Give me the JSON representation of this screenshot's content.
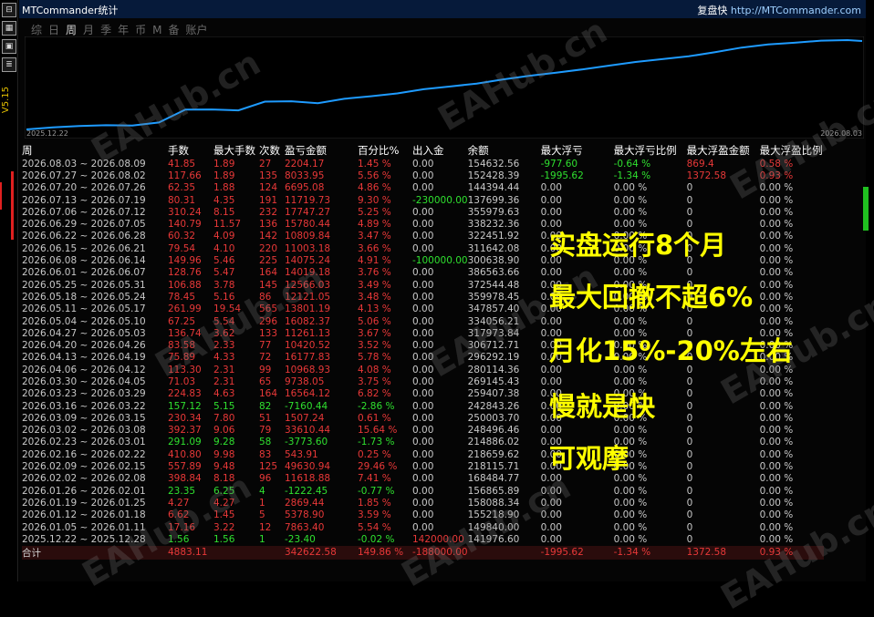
{
  "app": {
    "title": "MTCommander统计",
    "brand": "复盘快",
    "url": "http://MTCommander.com",
    "version": "V5.15"
  },
  "left_icons": [
    "minimize-icon",
    "grid-icon",
    "panel-icon",
    "list-icon",
    "check-icon"
  ],
  "left_icon_glyphs": [
    "⊟",
    "▦",
    "▣",
    "≣",
    "✓"
  ],
  "tabs": [
    {
      "label": "综"
    },
    {
      "label": "日"
    },
    {
      "label": "周"
    },
    {
      "label": "月"
    },
    {
      "label": "季"
    },
    {
      "label": "年"
    },
    {
      "label": "币"
    },
    {
      "label": "M"
    },
    {
      "label": "备"
    },
    {
      "label": "账户"
    }
  ],
  "active_tab_index": 2,
  "chart": {
    "start_label": "2025.12.22",
    "end_label": "2026.08.03",
    "line_color": "#1e9bff"
  },
  "columns": [
    "周",
    "手数",
    "最大手数",
    "次数",
    "盈亏金额",
    "百分比%",
    "出入金",
    "余额",
    "最大浮亏",
    "最大浮亏比例",
    "最大浮盈金额",
    "最大浮盈比例"
  ],
  "rows": [
    [
      "2026.08.03 ~ 2026.08.09",
      "41.85",
      "1.89",
      "27",
      "2204.17",
      "1.45 %",
      "0.00",
      "154632.56",
      "-977.60",
      "-0.64 %",
      "869.4",
      "0.58 %"
    ],
    [
      "2026.07.27 ~ 2026.08.02",
      "117.66",
      "1.89",
      "135",
      "8033.95",
      "5.56 %",
      "0.00",
      "152428.39",
      "-1995.62",
      "-1.34 %",
      "1372.58",
      "0.93 %"
    ],
    [
      "2026.07.20 ~ 2026.07.26",
      "62.35",
      "1.88",
      "124",
      "6695.08",
      "4.86 %",
      "0.00",
      "144394.44",
      "0.00",
      "0.00 %",
      "0",
      "0.00 %"
    ],
    [
      "2026.07.13 ~ 2026.07.19",
      "80.31",
      "4.35",
      "191",
      "11719.73",
      "9.30 %",
      "-230000.00",
      "137699.36",
      "0.00",
      "0.00 %",
      "0",
      "0.00 %"
    ],
    [
      "2026.07.06 ~ 2026.07.12",
      "310.24",
      "8.15",
      "232",
      "17747.27",
      "5.25 %",
      "0.00",
      "355979.63",
      "0.00",
      "0.00 %",
      "0",
      "0.00 %"
    ],
    [
      "2026.06.29 ~ 2026.07.05",
      "140.79",
      "11.57",
      "136",
      "15780.44",
      "4.89 %",
      "0.00",
      "338232.36",
      "0.00",
      "0.00 %",
      "0",
      "0.00 %"
    ],
    [
      "2026.06.22 ~ 2026.06.28",
      "60.32",
      "4.09",
      "142",
      "10809.84",
      "3.47 %",
      "0.00",
      "322451.92",
      "0.00",
      "0.00 %",
      "0",
      "0.00 %"
    ],
    [
      "2026.06.15 ~ 2026.06.21",
      "79.54",
      "4.10",
      "220",
      "11003.18",
      "3.66 %",
      "0.00",
      "311642.08",
      "0.00",
      "0.00 %",
      "0",
      "0.00 %"
    ],
    [
      "2026.06.08 ~ 2026.06.14",
      "149.96",
      "5.46",
      "225",
      "14075.24",
      "4.91 %",
      "-100000.00",
      "300638.90",
      "0.00",
      "0.00 %",
      "0",
      "0.00 %"
    ],
    [
      "2026.06.01 ~ 2026.06.07",
      "128.76",
      "5.47",
      "164",
      "14019.18",
      "3.76 %",
      "0.00",
      "386563.66",
      "0.00",
      "0.00 %",
      "0",
      "0.00 %"
    ],
    [
      "2026.05.25 ~ 2026.05.31",
      "106.88",
      "3.78",
      "145",
      "12566.03",
      "3.49 %",
      "0.00",
      "372544.48",
      "0.00",
      "0.00 %",
      "0",
      "0.00 %"
    ],
    [
      "2026.05.18 ~ 2026.05.24",
      "78.45",
      "5.16",
      "86",
      "12121.05",
      "3.48 %",
      "0.00",
      "359978.45",
      "0.00",
      "0.00 %",
      "0",
      "0.00 %"
    ],
    [
      "2026.05.11 ~ 2026.05.17",
      "261.99",
      "19.54",
      "565",
      "13801.19",
      "4.13 %",
      "0.00",
      "347857.40",
      "0.00",
      "0.00 %",
      "0",
      "0.00 %"
    ],
    [
      "2026.05.04 ~ 2026.05.10",
      "67.25",
      "5.54",
      "296",
      "16082.37",
      "5.06 %",
      "0.00",
      "334056.21",
      "0.00",
      "0.00 %",
      "0",
      "0.00 %"
    ],
    [
      "2026.04.27 ~ 2026.05.03",
      "136.74",
      "3.62",
      "133",
      "11261.13",
      "3.67 %",
      "0.00",
      "317973.84",
      "0.00",
      "0.00 %",
      "0",
      "0.00 %"
    ],
    [
      "2026.04.20 ~ 2026.04.26",
      "83.58",
      "2.33",
      "77",
      "10420.52",
      "3.52 %",
      "0.00",
      "306712.71",
      "0.00",
      "0.00 %",
      "0",
      "0.00 %"
    ],
    [
      "2026.04.13 ~ 2026.04.19",
      "75.89",
      "4.33",
      "72",
      "16177.83",
      "5.78 %",
      "0.00",
      "296292.19",
      "0.00",
      "0.00 %",
      "0",
      "0.00 %"
    ],
    [
      "2026.04.06 ~ 2026.04.12",
      "113.30",
      "2.31",
      "99",
      "10968.93",
      "4.08 %",
      "0.00",
      "280114.36",
      "0.00",
      "0.00 %",
      "0",
      "0.00 %"
    ],
    [
      "2026.03.30 ~ 2026.04.05",
      "71.03",
      "2.31",
      "65",
      "9738.05",
      "3.75 %",
      "0.00",
      "269145.43",
      "0.00",
      "0.00 %",
      "0",
      "0.00 %"
    ],
    [
      "2026.03.23 ~ 2026.03.29",
      "224.83",
      "4.63",
      "164",
      "16564.12",
      "6.82 %",
      "0.00",
      "259407.38",
      "0.00",
      "0.00 %",
      "0",
      "0.00 %"
    ],
    [
      "2026.03.16 ~ 2026.03.22",
      "157.12",
      "5.15",
      "82",
      "-7160.44",
      "-2.86 %",
      "0.00",
      "242843.26",
      "0.00",
      "0.00 %",
      "0",
      "0.00 %"
    ],
    [
      "2026.03.09 ~ 2026.03.15",
      "230.34",
      "7.80",
      "51",
      "1507.24",
      "0.61 %",
      "0.00",
      "250003.70",
      "0.00",
      "0.00 %",
      "0",
      "0.00 %"
    ],
    [
      "2026.03.02 ~ 2026.03.08",
      "392.37",
      "9.06",
      "79",
      "33610.44",
      "15.64 %",
      "0.00",
      "248496.46",
      "0.00",
      "0.00 %",
      "0",
      "0.00 %"
    ],
    [
      "2026.02.23 ~ 2026.03.01",
      "291.09",
      "9.28",
      "58",
      "-3773.60",
      "-1.73 %",
      "0.00",
      "214886.02",
      "0.00",
      "0.00 %",
      "0",
      "0.00 %"
    ],
    [
      "2026.02.16 ~ 2026.02.22",
      "410.80",
      "9.98",
      "83",
      "543.91",
      "0.25 %",
      "0.00",
      "218659.62",
      "0.00",
      "0.00 %",
      "0",
      "0.00 %"
    ],
    [
      "2026.02.09 ~ 2026.02.15",
      "557.89",
      "9.48",
      "125",
      "49630.94",
      "29.46 %",
      "0.00",
      "218115.71",
      "0.00",
      "0.00 %",
      "0",
      "0.00 %"
    ],
    [
      "2026.02.02 ~ 2026.02.08",
      "398.84",
      "8.18",
      "96",
      "11618.88",
      "7.41 %",
      "0.00",
      "168484.77",
      "0.00",
      "0.00 %",
      "0",
      "0.00 %"
    ],
    [
      "2026.01.26 ~ 2026.02.01",
      "23.35",
      "6.25",
      "4",
      "-1222.45",
      "-0.77 %",
      "0.00",
      "156865.89",
      "0.00",
      "0.00 %",
      "0",
      "0.00 %"
    ],
    [
      "2026.01.19 ~ 2026.01.25",
      "4.27",
      "4.27",
      "1",
      "2869.44",
      "1.85 %",
      "0.00",
      "158088.34",
      "0.00",
      "0.00 %",
      "0",
      "0.00 %"
    ],
    [
      "2026.01.12 ~ 2026.01.18",
      "6.62",
      "1.45",
      "5",
      "5378.90",
      "3.59 %",
      "0.00",
      "155218.90",
      "0.00",
      "0.00 %",
      "0",
      "0.00 %"
    ],
    [
      "2026.01.05 ~ 2026.01.11",
      "17.16",
      "3.22",
      "12",
      "7863.40",
      "5.54 %",
      "0.00",
      "149840.00",
      "0.00",
      "0.00 %",
      "0",
      "0.00 %"
    ],
    [
      "2025.12.22 ~ 2025.12.28",
      "1.56",
      "1.56",
      "1",
      "-23.40",
      "-0.02 %",
      "142000.00",
      "141976.60",
      "0.00",
      "0.00 %",
      "0",
      "0.00 %"
    ]
  ],
  "total": [
    "合计",
    "4883.11",
    "",
    "",
    "342622.58",
    "149.86 %",
    "-188000.00",
    "",
    "-1995.62",
    "-1.34 %",
    "1372.58",
    "0.93 %"
  ],
  "overlay_lines": [
    "实盘运行8个月",
    "最大回撤不超6%",
    "月化15%-20%左右",
    "慢就是快",
    "可观摩"
  ],
  "watermark": "EAHub.cn",
  "colors": {
    "positive": "#e83838",
    "negative": "#2fe02f",
    "neutral": "#c8c8c8",
    "overlay": "#ffff00",
    "titlebar": "#061a3a"
  }
}
